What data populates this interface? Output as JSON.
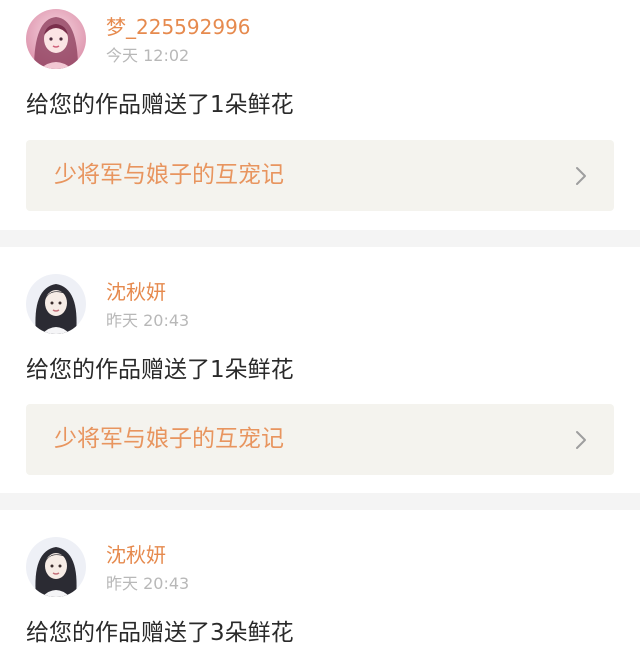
{
  "notifications": [
    {
      "username": "梦_225592996",
      "time": "今天 12:02",
      "message": "给您的作品赠送了1朵鲜花",
      "work_title": "少将军与娘子的互宠记",
      "avatar_icon": "user-avatar-pink"
    },
    {
      "username": "沈秋妍",
      "time": "昨天 20:43",
      "message": "给您的作品赠送了1朵鲜花",
      "work_title": "少将军与娘子的互宠记",
      "avatar_icon": "user-avatar-dark-hair"
    },
    {
      "username": "沈秋妍",
      "time": "昨天 20:43",
      "message": "给您的作品赠送了3朵鲜花",
      "avatar_icon": "user-avatar-dark-hair"
    }
  ],
  "colors": {
    "username": "#e68a4e",
    "work_title": "#e8955f",
    "timestamp": "#b8b8b8",
    "message": "#2a2a2a",
    "link_bg": "#f4f3ee",
    "divider": "#f4f4f4"
  }
}
